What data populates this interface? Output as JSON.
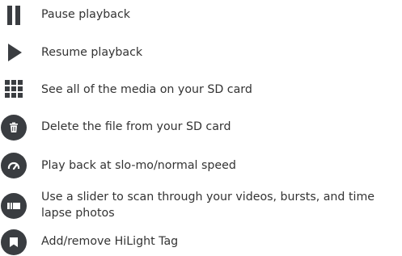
{
  "colors": {
    "icon": "#3a3d41",
    "text": "#333333",
    "background": "#ffffff"
  },
  "items": [
    {
      "icon": "pause-icon",
      "label": "Pause playback"
    },
    {
      "icon": "play-icon",
      "label": "Resume playback"
    },
    {
      "icon": "grid-icon",
      "label": "See all of the media on your SD card"
    },
    {
      "icon": "trash-icon",
      "label": "Delete the file from your SD card"
    },
    {
      "icon": "speedometer-icon",
      "label": "Play back at slo-mo/normal speed"
    },
    {
      "icon": "scrubber-icon",
      "label": "Use a slider to scan through your videos, bursts, and time lapse photos"
    },
    {
      "icon": "hilight-tag-icon",
      "label": "Add/remove HiLight Tag"
    }
  ]
}
